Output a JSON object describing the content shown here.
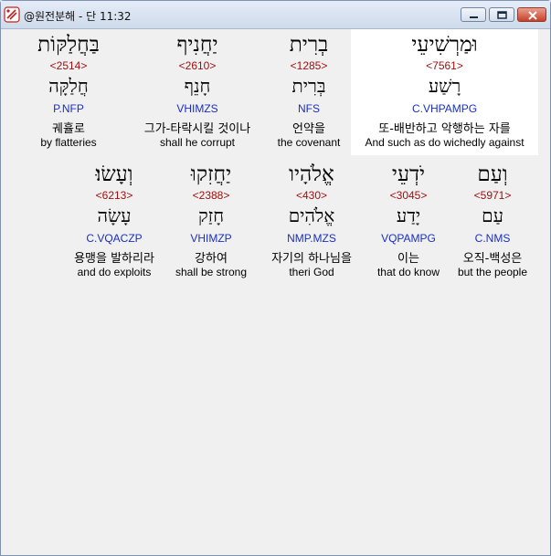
{
  "window": {
    "title": "@원전분해 - 단 11:32",
    "controls": [
      "minimize-icon",
      "maximize-icon",
      "close-icon"
    ]
  },
  "rows": [
    {
      "cells": [
        {
          "hebrew": "בַּחֲלַקּוֹת",
          "strong": "<2514>",
          "lemma": "חֲלַקָּה",
          "parsing": "P.NFP",
          "korean": "궤휼로",
          "english": "by flatteries"
        },
        {
          "hebrew": "יַחֲנִיף",
          "strong": "<2610>",
          "lemma": "חָנֵף",
          "parsing": "VHIMZS",
          "korean": "그가-타락시킬 것이나",
          "english": "shall he corrupt"
        },
        {
          "hebrew": "בְרִית",
          "strong": "<1285>",
          "lemma": "בְּרִית",
          "parsing": "NFS",
          "korean": "언약을",
          "english": "the covenant"
        },
        {
          "hebrew": "וּמַרְשִׁיעֵי",
          "strong": "<7561>",
          "lemma": "רָשַׁע",
          "parsing": "C.VHPAMPG",
          "korean": "또-배반하고 악행하는 자를",
          "english": "And such as do wichedly against"
        }
      ]
    },
    {
      "cells": [
        {
          "hebrew": "וְעָשׂוּ׃",
          "strong": "<6213>",
          "lemma": "עָשָׂה",
          "parsing": "C.VQACZP",
          "korean": "용맹을 발하리라",
          "english": "and do exploits"
        },
        {
          "hebrew": "יַחֲזִקוּ",
          "strong": "<2388>",
          "lemma": "חָזַק",
          "parsing": "VHIMZP",
          "korean": "강하여",
          "english": "shall be strong"
        },
        {
          "hebrew": "אֱלֹהָיו",
          "strong": "<430>",
          "lemma": "אֱלֹהִים",
          "parsing": "NMP.MZS",
          "korean": "자기의 하나님을",
          "english": "theri God"
        },
        {
          "hebrew": "יֹדְעֵי",
          "strong": "<3045>",
          "lemma": "יָדַע",
          "parsing": "VQPAMPG",
          "korean": "이는",
          "english": "that do know"
        },
        {
          "hebrew": "וְעַם",
          "strong": "<5971>",
          "lemma": "עַם",
          "parsing": "C.NMS",
          "korean": "오직-백성은",
          "english": "but the people"
        }
      ]
    }
  ],
  "colors": {
    "strong_number": "#a01010",
    "parsing_code": "#1a2fbf",
    "highlight_bg": "#ffffff",
    "content_bg": "#f0f0f0"
  }
}
